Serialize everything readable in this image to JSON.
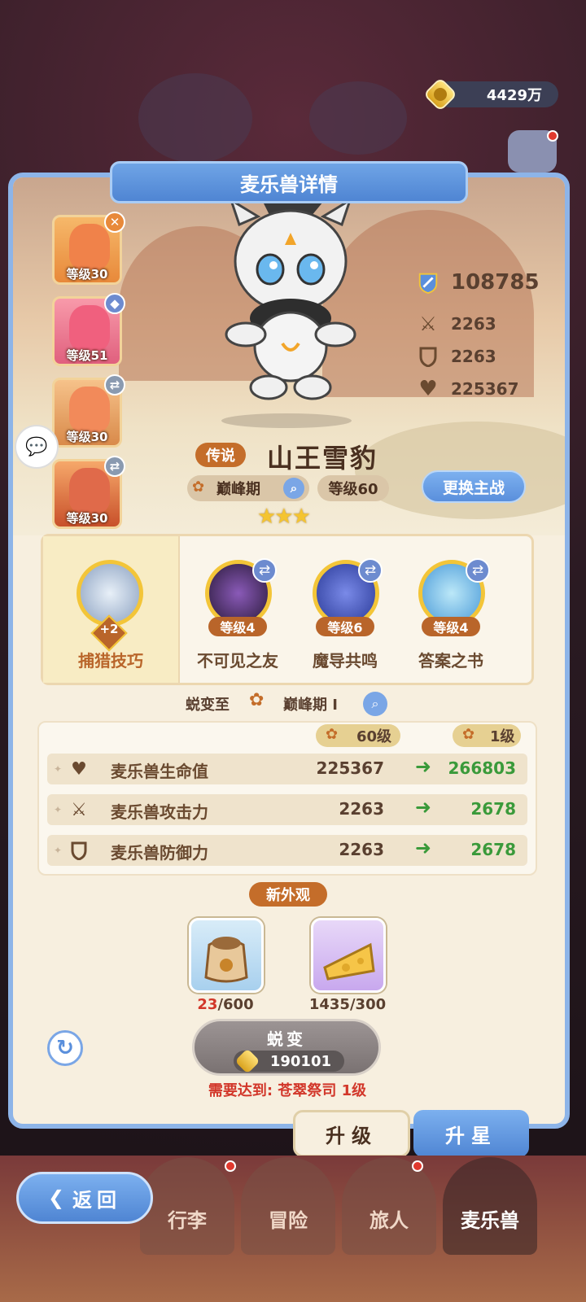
{
  "currency": {
    "amount": "4429万",
    "icon": "gold-coin-icon"
  },
  "panel": {
    "title": "麦乐兽详情"
  },
  "pet_list": [
    {
      "level": "等级30",
      "badge": "✕",
      "badge_color": "#e8893a",
      "color": "#f0824a"
    },
    {
      "level": "等级51",
      "badge": "◆",
      "badge_color": "#6d8bcf",
      "color": "#f0607e"
    },
    {
      "level": "等级30",
      "badge": "⇄",
      "badge_color": "#8a9ab0",
      "color": "#f28a5a"
    },
    {
      "level": "等级30",
      "badge": "⇄",
      "badge_color": "#8a9ab0",
      "color": "#e06a4a"
    }
  ],
  "stats": {
    "power": "108785",
    "attack": "2263",
    "defense": "2263",
    "hp": "225367"
  },
  "pet": {
    "rarity": "传说",
    "name": "山王雪豹",
    "stage": "巅峰期",
    "level": "等级60",
    "swap_label": "更换主战",
    "stars": "★★★"
  },
  "skills": [
    {
      "name": "捕猎技巧",
      "level": "+2",
      "color": "#c8d8e8"
    },
    {
      "name": "不可见之友",
      "level": "等级4",
      "color": "#3a2a4a"
    },
    {
      "name": "魔导共鸣",
      "level": "等级6",
      "color": "#4a5ab8"
    },
    {
      "name": "答案之书",
      "level": "等级4",
      "color": "#7ac8e8"
    }
  ],
  "evolve": {
    "prefix": "蜕变至",
    "stage": "巅峰期 I",
    "from_level": "60级",
    "to_level": "1级",
    "rows": [
      {
        "label": "麦乐兽生命值",
        "old": "225367",
        "new": "266803",
        "icon": "heart-icon"
      },
      {
        "label": "麦乐兽攻击力",
        "old": "2263",
        "new": "2678",
        "icon": "swords-icon"
      },
      {
        "label": "麦乐兽防御力",
        "old": "2263",
        "new": "2678",
        "icon": "shield-icon"
      }
    ],
    "arrow": "➜"
  },
  "new_look": "新外观",
  "materials": [
    {
      "have": "23",
      "need": "/600",
      "have_color": "#d2372a"
    },
    {
      "have": "1435",
      "need": "/300",
      "have_color": "#5a4030"
    }
  ],
  "evolve_button": {
    "label": "蜕变",
    "cost": "190101"
  },
  "requirement": "需要达到: 苍翠祭司 1级",
  "tabs": {
    "upgrade": "升级",
    "star": "升星"
  },
  "nav": {
    "back": "返回",
    "items": [
      "行李",
      "冒险",
      "旅人",
      "麦乐兽"
    ]
  }
}
